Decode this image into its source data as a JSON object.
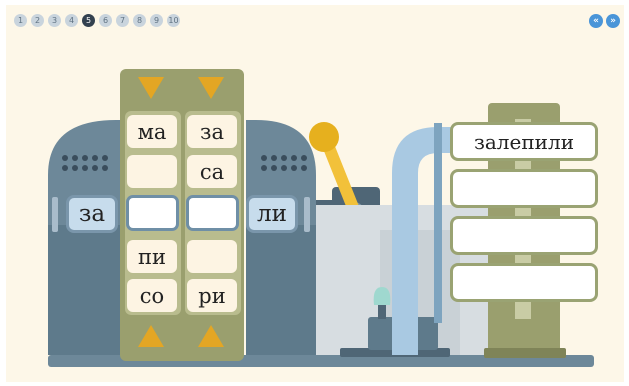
{
  "pager": {
    "pages": [
      "1",
      "2",
      "3",
      "4",
      "5",
      "6",
      "7",
      "8",
      "9",
      "10"
    ],
    "current": 5
  },
  "nav": {
    "prev_icon": "«",
    "next_icon": "»"
  },
  "machine": {
    "prefix": "за",
    "suffix": "ли",
    "left_reel": [
      "ма",
      "",
      "",
      "пи",
      "со"
    ],
    "right_reel": [
      "за",
      "са",
      "",
      "",
      "ри"
    ]
  },
  "results": [
    "залепили",
    "",
    "",
    ""
  ],
  "colors": {
    "background": "#fdf7e8",
    "reel_frame": "#9a9f6e",
    "arrow": "#e3a624",
    "machine_body": "#6d8899",
    "pipe": "#a9c9e2",
    "active_page": "#33414f",
    "nav_button": "#4a95d8"
  }
}
